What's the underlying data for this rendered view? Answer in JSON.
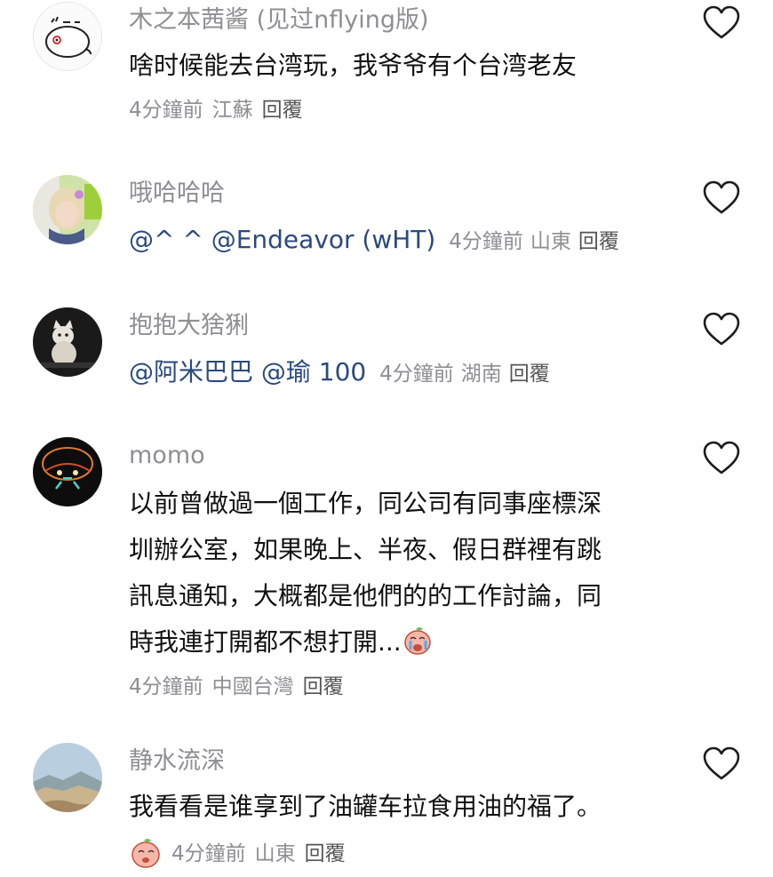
{
  "comments": [
    {
      "username": "木之本茜酱 (见过nflying版)",
      "text": "啥时候能去台湾玩，我爷爷有个台湾老友",
      "time": "4分鐘前",
      "location": "江蘇",
      "reply": "回覆",
      "avatar_icon": "cartoon-rabbit-avatar"
    },
    {
      "username": "哦哈哈哈",
      "mentions": "@^ ^ @Endeavor (wHT)",
      "time": "4分鐘前",
      "location": "山東",
      "reply": "回覆",
      "avatar_icon": "girl-photo-avatar"
    },
    {
      "username": "抱抱大猞猁",
      "mentions": "@阿米巴巴 @瑜 100",
      "time": "4分鐘前",
      "location": "湖南",
      "reply": "回覆",
      "avatar_icon": "cat-photo-avatar"
    },
    {
      "username": "momo",
      "text_lines": [
        "以前曾做過一個工作，同公司有同事座標深",
        "圳辦公室，如果晚上、半夜、假日群裡有跳",
        "訊息通知，大概都是他們的的工作討論，同",
        "時我連打開都不想打開..."
      ],
      "time": "4分鐘前",
      "location": "中國台灣",
      "reply": "回覆",
      "avatar_icon": "neon-face-avatar",
      "trailing_emoji": "crying-peach-emoji"
    },
    {
      "username": "静水流深",
      "text": "我看看是谁享到了油罐车拉食用油的福了。",
      "time": "4分鐘前",
      "location": "山東",
      "reply": "回覆",
      "avatar_icon": "mountain-photo-avatar",
      "leading_emoji": "peach-emoji"
    }
  ],
  "colors": {
    "username": "#8e8e93",
    "text": "#111111",
    "mention": "#2a4a7f",
    "heart_stroke": "#1c1c1e"
  }
}
